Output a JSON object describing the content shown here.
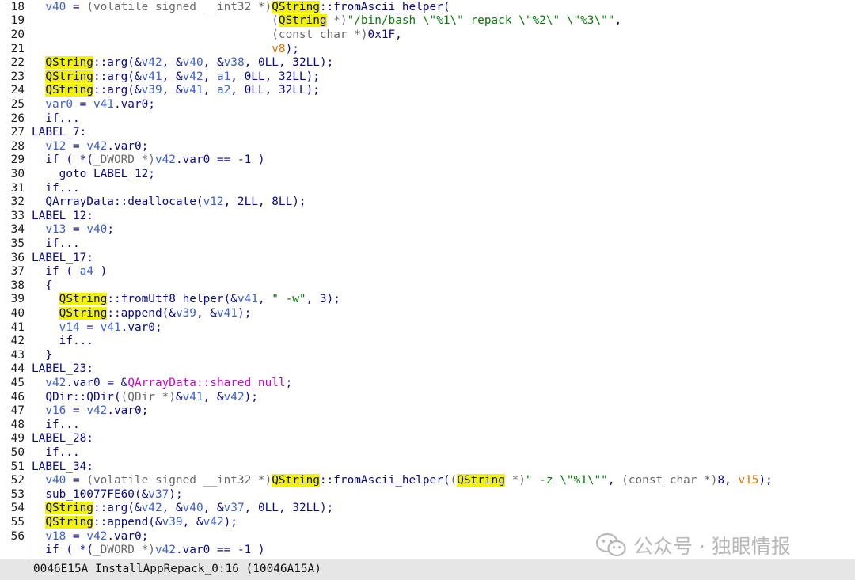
{
  "colors": {
    "keyword": "#0a0a8a",
    "variable": "#3a5fcd",
    "cast": "#6a6a6a",
    "string": "#0a7a0a",
    "argument": "#e07000",
    "global": "#d000d0",
    "highlight": "#f3f300"
  },
  "lines": [
    {
      "num": "18",
      "tokens": [
        {
          "t": "  ",
          "c": "tx"
        },
        {
          "t": "v40",
          "c": "va"
        },
        {
          "t": " = ",
          "c": "tx"
        },
        {
          "t": "(volatile signed __int32 *)",
          "c": "ca"
        },
        {
          "t": "QString",
          "c": "hl"
        },
        {
          "t": "::fromAscii_helper(",
          "c": "kw"
        }
      ]
    },
    {
      "num": "19",
      "tokens": [
        {
          "t": "                                   (",
          "c": "ca"
        },
        {
          "t": "QString",
          "c": "hl"
        },
        {
          "t": " *)",
          "c": "ca"
        },
        {
          "t": "\"/bin/bash \\\"%1\\\" repack \\\"%2\\\" \\\"%3\\\"\"",
          "c": "st"
        },
        {
          "t": ",",
          "c": "tx"
        }
      ]
    },
    {
      "num": "20",
      "tokens": [
        {
          "t": "                                   (const char *)",
          "c": "ca"
        },
        {
          "t": "0x1F,",
          "c": "tx"
        }
      ]
    },
    {
      "num": "21",
      "tokens": [
        {
          "t": "                                   ",
          "c": "tx"
        },
        {
          "t": "v8",
          "c": "ar"
        },
        {
          "t": ");",
          "c": "tx"
        }
      ]
    },
    {
      "num": "22",
      "tokens": [
        {
          "t": "  ",
          "c": "tx"
        },
        {
          "t": "QString",
          "c": "hl"
        },
        {
          "t": "::arg(&",
          "c": "kw"
        },
        {
          "t": "v42",
          "c": "va"
        },
        {
          "t": ", &",
          "c": "tx"
        },
        {
          "t": "v40",
          "c": "va"
        },
        {
          "t": ", &",
          "c": "tx"
        },
        {
          "t": "v38",
          "c": "va"
        },
        {
          "t": ", 0LL, 32LL);",
          "c": "tx"
        }
      ]
    },
    {
      "num": "23",
      "tokens": [
        {
          "t": "  ",
          "c": "tx"
        },
        {
          "t": "QString",
          "c": "hl"
        },
        {
          "t": "::arg(&",
          "c": "kw"
        },
        {
          "t": "v41",
          "c": "va"
        },
        {
          "t": ", &",
          "c": "tx"
        },
        {
          "t": "v42",
          "c": "va"
        },
        {
          "t": ", ",
          "c": "tx"
        },
        {
          "t": "a1",
          "c": "va"
        },
        {
          "t": ", 0LL, 32LL);",
          "c": "tx"
        }
      ]
    },
    {
      "num": "24",
      "tokens": [
        {
          "t": "  ",
          "c": "tx"
        },
        {
          "t": "QString",
          "c": "hl"
        },
        {
          "t": "::arg(&",
          "c": "kw"
        },
        {
          "t": "v39",
          "c": "va"
        },
        {
          "t": ", &",
          "c": "tx"
        },
        {
          "t": "v41",
          "c": "va"
        },
        {
          "t": ", ",
          "c": "tx"
        },
        {
          "t": "a2",
          "c": "va"
        },
        {
          "t": ", 0LL, 32LL);",
          "c": "tx"
        }
      ]
    },
    {
      "num": "25",
      "tokens": [
        {
          "t": "  ",
          "c": "tx"
        },
        {
          "t": "var0",
          "c": "va"
        },
        {
          "t": " = ",
          "c": "tx"
        },
        {
          "t": "v41",
          "c": "va"
        },
        {
          "t": ".var0;",
          "c": "tx"
        }
      ]
    },
    {
      "num": "26",
      "tokens": [
        {
          "t": "  if...",
          "c": "kw"
        }
      ]
    },
    {
      "num": "27",
      "tokens": [
        {
          "t": "LABEL_7:",
          "c": "kw"
        }
      ]
    },
    {
      "num": "28",
      "tokens": [
        {
          "t": "  ",
          "c": "tx"
        },
        {
          "t": "v12",
          "c": "va"
        },
        {
          "t": " = ",
          "c": "tx"
        },
        {
          "t": "v42",
          "c": "va"
        },
        {
          "t": ".var0;",
          "c": "tx"
        }
      ]
    },
    {
      "num": "29",
      "tokens": [
        {
          "t": "  if ( *(",
          "c": "kw"
        },
        {
          "t": "_DWORD *)",
          "c": "ca"
        },
        {
          "t": "v42",
          "c": "va"
        },
        {
          "t": ".var0 == -1 )",
          "c": "tx"
        }
      ]
    },
    {
      "num": "30",
      "tokens": [
        {
          "t": "    goto LABEL_12;",
          "c": "kw"
        }
      ]
    },
    {
      "num": "31",
      "tokens": [
        {
          "t": "  if...",
          "c": "kw"
        }
      ]
    },
    {
      "num": "32",
      "tokens": [
        {
          "t": "  QArrayData::deallocate(",
          "c": "kw"
        },
        {
          "t": "v12",
          "c": "va"
        },
        {
          "t": ", 2LL, 8LL);",
          "c": "tx"
        }
      ]
    },
    {
      "num": "33",
      "tokens": [
        {
          "t": "LABEL_12:",
          "c": "kw"
        }
      ]
    },
    {
      "num": "34",
      "tokens": [
        {
          "t": "  ",
          "c": "tx"
        },
        {
          "t": "v13",
          "c": "va"
        },
        {
          "t": " = ",
          "c": "tx"
        },
        {
          "t": "v40",
          "c": "va"
        },
        {
          "t": ";",
          "c": "tx"
        }
      ]
    },
    {
      "num": "35",
      "tokens": [
        {
          "t": "  if...",
          "c": "kw"
        }
      ]
    },
    {
      "num": "36",
      "tokens": [
        {
          "t": "LABEL_17:",
          "c": "kw"
        }
      ]
    },
    {
      "num": "37",
      "tokens": [
        {
          "t": "  if ( ",
          "c": "kw"
        },
        {
          "t": "a4",
          "c": "va"
        },
        {
          "t": " )",
          "c": "tx"
        }
      ]
    },
    {
      "num": "38",
      "tokens": [
        {
          "t": "  {",
          "c": "tx"
        }
      ]
    },
    {
      "num": "39",
      "tokens": [
        {
          "t": "    ",
          "c": "tx"
        },
        {
          "t": "QString",
          "c": "hl"
        },
        {
          "t": "::fromUtf8_helper(&",
          "c": "kw"
        },
        {
          "t": "v41",
          "c": "va"
        },
        {
          "t": ", ",
          "c": "tx"
        },
        {
          "t": "\" -w\"",
          "c": "st"
        },
        {
          "t": ", 3);",
          "c": "tx"
        }
      ]
    },
    {
      "num": "40",
      "tokens": [
        {
          "t": "    ",
          "c": "tx"
        },
        {
          "t": "QString",
          "c": "hl"
        },
        {
          "t": "::append(&",
          "c": "kw"
        },
        {
          "t": "v39",
          "c": "va"
        },
        {
          "t": ", &",
          "c": "tx"
        },
        {
          "t": "v41",
          "c": "va"
        },
        {
          "t": ");",
          "c": "tx"
        }
      ]
    },
    {
      "num": "41",
      "tokens": [
        {
          "t": "    ",
          "c": "tx"
        },
        {
          "t": "v14",
          "c": "va"
        },
        {
          "t": " = ",
          "c": "tx"
        },
        {
          "t": "v41",
          "c": "va"
        },
        {
          "t": ".var0;",
          "c": "tx"
        }
      ]
    },
    {
      "num": "42",
      "tokens": [
        {
          "t": "    if...",
          "c": "kw"
        }
      ]
    },
    {
      "num": "43",
      "tokens": [
        {
          "t": "  }",
          "c": "tx"
        }
      ]
    },
    {
      "num": "44",
      "tokens": [
        {
          "t": "LABEL_23:",
          "c": "kw"
        }
      ]
    },
    {
      "num": "45",
      "tokens": [
        {
          "t": "  ",
          "c": "tx"
        },
        {
          "t": "v42",
          "c": "va"
        },
        {
          "t": ".var0 = &",
          "c": "tx"
        },
        {
          "t": "QArrayData::shared_null",
          "c": "gl"
        },
        {
          "t": ";",
          "c": "tx"
        }
      ]
    },
    {
      "num": "46",
      "tokens": [
        {
          "t": "  QDir::QDir(",
          "c": "kw"
        },
        {
          "t": "(QDir *)",
          "c": "ca"
        },
        {
          "t": "&",
          "c": "tx"
        },
        {
          "t": "v41",
          "c": "va"
        },
        {
          "t": ", &",
          "c": "tx"
        },
        {
          "t": "v42",
          "c": "va"
        },
        {
          "t": ");",
          "c": "tx"
        }
      ]
    },
    {
      "num": "47",
      "tokens": [
        {
          "t": "  ",
          "c": "tx"
        },
        {
          "t": "v16",
          "c": "va"
        },
        {
          "t": " = ",
          "c": "tx"
        },
        {
          "t": "v42",
          "c": "va"
        },
        {
          "t": ".var0;",
          "c": "tx"
        }
      ]
    },
    {
      "num": "48",
      "tokens": [
        {
          "t": "  if...",
          "c": "kw"
        }
      ]
    },
    {
      "num": "49",
      "tokens": [
        {
          "t": "LABEL_28:",
          "c": "kw"
        }
      ]
    },
    {
      "num": "50",
      "tokens": [
        {
          "t": "  if...",
          "c": "kw"
        }
      ]
    },
    {
      "num": "51",
      "tokens": [
        {
          "t": "LABEL_34:",
          "c": "kw"
        }
      ]
    },
    {
      "num": "52",
      "tokens": [
        {
          "t": "  ",
          "c": "tx"
        },
        {
          "t": "v40",
          "c": "va"
        },
        {
          "t": " = ",
          "c": "tx"
        },
        {
          "t": "(volatile signed __int32 *)",
          "c": "ca"
        },
        {
          "t": "QString",
          "c": "hl"
        },
        {
          "t": "::fromAscii_helper(",
          "c": "kw"
        },
        {
          "t": "(",
          "c": "ca"
        },
        {
          "t": "QString",
          "c": "hl"
        },
        {
          "t": " *)",
          "c": "ca"
        },
        {
          "t": "\" -z \\\"%1\\\"\"",
          "c": "st"
        },
        {
          "t": ", ",
          "c": "tx"
        },
        {
          "t": "(const char *)",
          "c": "ca"
        },
        {
          "t": "8, ",
          "c": "tx"
        },
        {
          "t": "v15",
          "c": "ar"
        },
        {
          "t": ");",
          "c": "tx"
        }
      ]
    },
    {
      "num": "53",
      "tokens": [
        {
          "t": "  sub_10077FE60(&",
          "c": "kw"
        },
        {
          "t": "v37",
          "c": "va"
        },
        {
          "t": ");",
          "c": "tx"
        }
      ]
    },
    {
      "num": "54",
      "tokens": [
        {
          "t": "  ",
          "c": "tx"
        },
        {
          "t": "QString",
          "c": "hl"
        },
        {
          "t": "::arg(&",
          "c": "kw"
        },
        {
          "t": "v42",
          "c": "va"
        },
        {
          "t": ", &",
          "c": "tx"
        },
        {
          "t": "v40",
          "c": "va"
        },
        {
          "t": ", &",
          "c": "tx"
        },
        {
          "t": "v37",
          "c": "va"
        },
        {
          "t": ", 0LL, 32LL);",
          "c": "tx"
        }
      ]
    },
    {
      "num": "55",
      "tokens": [
        {
          "t": "  ",
          "c": "tx"
        },
        {
          "t": "QString",
          "c": "hl"
        },
        {
          "t": "::append(&",
          "c": "kw"
        },
        {
          "t": "v39",
          "c": "va"
        },
        {
          "t": ", &",
          "c": "tx"
        },
        {
          "t": "v42",
          "c": "va"
        },
        {
          "t": ");",
          "c": "tx"
        }
      ]
    },
    {
      "num": "56",
      "tokens": [
        {
          "t": "  ",
          "c": "tx"
        },
        {
          "t": "v18",
          "c": "va"
        },
        {
          "t": " = ",
          "c": "tx"
        },
        {
          "t": "v42",
          "c": "va"
        },
        {
          "t": ".var0;",
          "c": "tx"
        }
      ]
    },
    {
      "num": "",
      "tokens": [
        {
          "t": "  if ( *(",
          "c": "kw"
        },
        {
          "t": "_DWORD *)",
          "c": "ca"
        },
        {
          "t": "v42",
          "c": "va"
        },
        {
          "t": ".var0 == -1 )",
          "c": "tx"
        }
      ]
    }
  ],
  "status": "0046E15A InstallAppRepack_0:16 (10046A15A)",
  "watermark": {
    "icon": "wechat-icon",
    "text": "公众号 · 独眼情报"
  }
}
